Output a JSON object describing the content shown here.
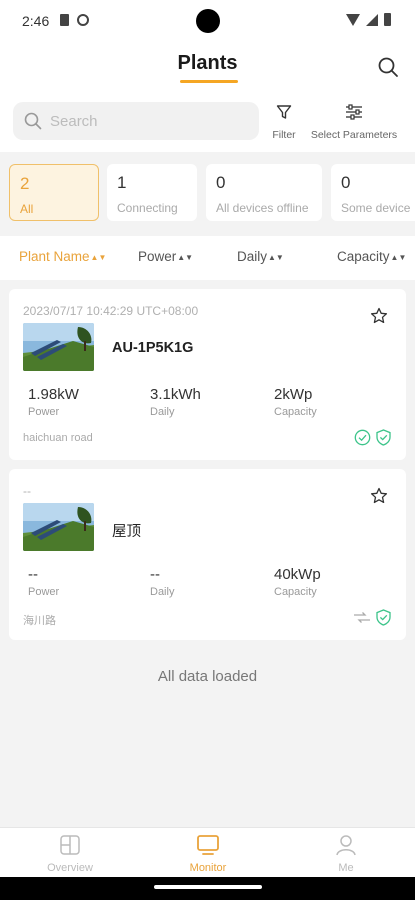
{
  "status_bar": {
    "time": "2:46"
  },
  "header": {
    "title": "Plants",
    "search_icon": "search-icon"
  },
  "toolbar": {
    "search_placeholder": "Search",
    "filter_label": "Filter",
    "params_label": "Select Parameters"
  },
  "status_tabs": [
    {
      "count": "2",
      "label": "All",
      "active": true
    },
    {
      "count": "1",
      "label": "Connecting",
      "active": false
    },
    {
      "count": "0",
      "label": "All devices offline",
      "active": false
    },
    {
      "count": "0",
      "label": "Some device",
      "active": false
    }
  ],
  "sort_bar": {
    "plant_name": "Plant Name",
    "power": "Power",
    "daily": "Daily",
    "capacity": "Capacity",
    "sort_icon": "sort-arrows-icon"
  },
  "plants": [
    {
      "timestamp": "2023/07/17 10:42:29 UTC+08:00",
      "name": "AU-1P5K1G",
      "power": "1.98kW",
      "power_label": "Power",
      "daily": "3.1kWh",
      "daily_label": "Daily",
      "capacity": "2kWp",
      "capacity_label": "Capacity",
      "address": "haichuan road"
    },
    {
      "timestamp": "--",
      "name": "屋顶",
      "power": "--",
      "power_label": "Power",
      "daily": "--",
      "daily_label": "Daily",
      "capacity": "40kWp",
      "capacity_label": "Capacity",
      "address": "海川路"
    }
  ],
  "footer_text": "All data loaded",
  "bottom_nav": [
    {
      "label": "Overview",
      "icon": "overview-icon",
      "active": false
    },
    {
      "label": "Monitor",
      "icon": "monitor-icon",
      "active": true
    },
    {
      "label": "Me",
      "icon": "person-icon",
      "active": false
    }
  ],
  "colors": {
    "accent": "#e9a33b",
    "status_ok": "#3cc48a"
  }
}
